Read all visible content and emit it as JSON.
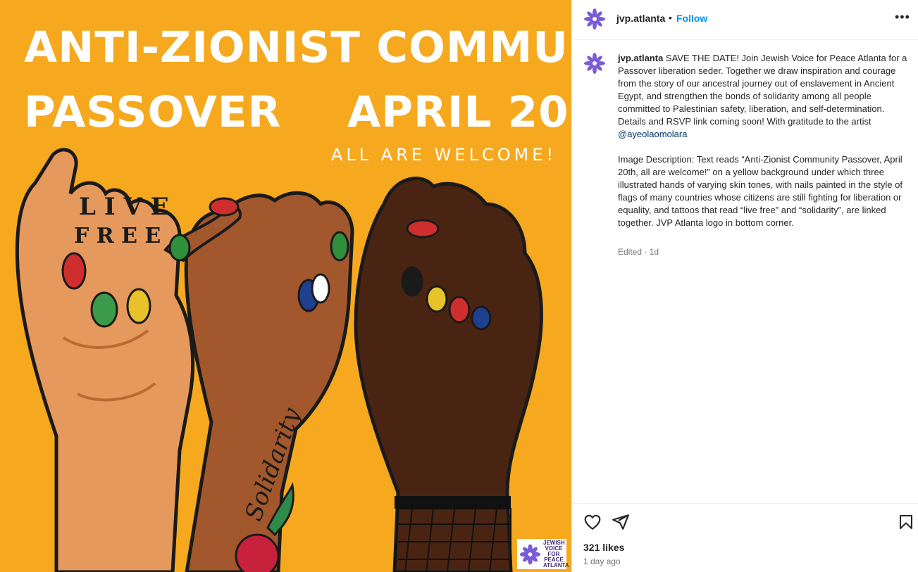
{
  "post_image": {
    "headline_line1": "ANTI-ZIONIST COMMUNITY",
    "headline_line2_left": "PASSOVER",
    "headline_line2_right": "APRIL 20",
    "subline": "ALL ARE WELCOME!",
    "tattoo_finger_text": "LIVE FREE",
    "tattoo_arm_text": "Solidarity",
    "logo_text": "JEWISH VOICE FOR PEACE ATLANTA"
  },
  "header": {
    "username": "jvp.atlanta",
    "separator": "•",
    "follow_label": "Follow",
    "more_label": "•••"
  },
  "caption": {
    "username": "jvp.atlanta",
    "text": " SAVE THE DATE! Join Jewish Voice for Peace Atlanta for a Passover liberation seder. Together we draw inspiration and courage from the story of our ancestral journey out of enslavement in Ancient Egypt, and strengthen the bonds of solidarity among all people committed to Palestinian safety, liberation, and self-determination. Details and RSVP link coming soon! With gratitude to the artist ",
    "mention": "@ayeolaomolara",
    "image_description": "Image Description: Text reads “Anti-Zionist Community Passover, April 20th, all are welcome!” on a yellow background under which three illustrated hands of varying skin tones, with nails painted in the style of flags of many countries whose citizens are still fighting for liberation or equality, and tattoos that read “live free” and “solidarity”, are linked together. JVP Atlanta logo in bottom corner.",
    "edited_label": "Edited · 1d"
  },
  "footer": {
    "likes": "321 likes",
    "timestamp": "1 day ago"
  },
  "colors": {
    "image_background": "#f6a91e",
    "brand_purple": "#7b5cd6",
    "link_blue": "#0095f6",
    "mention_blue": "#00376b"
  },
  "icons": {
    "avatar": "jvp-flower-logo-icon",
    "like": "heart-outline-icon",
    "share": "paper-plane-icon",
    "save": "bookmark-outline-icon",
    "more": "ellipsis-icon"
  }
}
